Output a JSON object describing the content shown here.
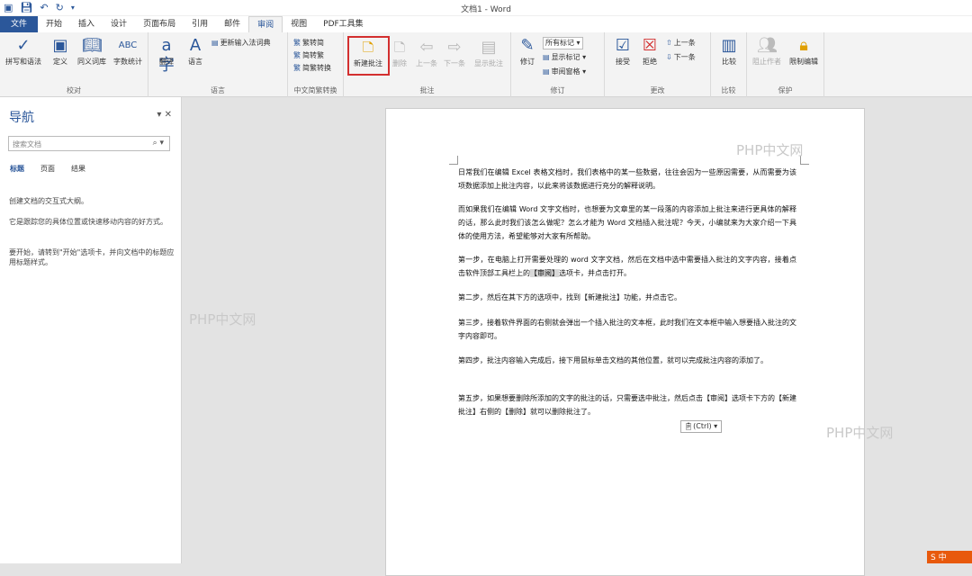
{
  "app": {
    "title": "文档1 - Word"
  },
  "quick_access": {
    "save_icon": "save-icon",
    "undo_icon": "undo-icon",
    "redo_icon": "redo-icon"
  },
  "tabs": [
    {
      "label": "文件"
    },
    {
      "label": "开始"
    },
    {
      "label": "插入"
    },
    {
      "label": "设计"
    },
    {
      "label": "页面布局"
    },
    {
      "label": "引用"
    },
    {
      "label": "邮件"
    },
    {
      "label": "审阅"
    },
    {
      "label": "视图"
    },
    {
      "label": "PDF工具集"
    }
  ],
  "ribbon": {
    "proofing": {
      "label": "校对",
      "spell": "拼写和语法",
      "define": "定义",
      "thesaurus": "同义词库",
      "wordcount": "字数统计"
    },
    "language": {
      "label": "语言",
      "translate": "翻译",
      "language": "语言",
      "update_ime": "更新输入法词典"
    },
    "chinese": {
      "label": "中文简繁转换",
      "to_simp": "繁转简",
      "to_trad": "简转繁",
      "convert": "简繁转换"
    },
    "comments": {
      "label": "批注",
      "new": "新建批注",
      "delete": "删除",
      "prev": "上一条",
      "next": "下一条",
      "show": "显示批注"
    },
    "tracking": {
      "label": "修订",
      "track": "修订",
      "all_markup": "所有标记",
      "show_markup": "显示标记",
      "review_pane": "审阅窗格"
    },
    "changes": {
      "label": "更改",
      "accept": "接受",
      "reject": "拒绝",
      "prev": "上一条",
      "next": "下一条"
    },
    "compare": {
      "label": "比较",
      "compare": "比较"
    },
    "protect": {
      "label": "保护",
      "block": "阻止作者",
      "restrict": "限制编辑"
    }
  },
  "nav": {
    "title": "导航",
    "search_placeholder": "搜索文档",
    "tabs": [
      "标题",
      "页面",
      "结果"
    ],
    "p1": "创建文档的交互式大纲。",
    "p2": "它是跟踪您的具体位置或快速移动内容的好方式。",
    "p3": "要开始，请转到\"开始\"选项卡，并向文档中的标题应用标题样式。"
  },
  "document": {
    "p1": "日常我们在编辑 Excel 表格文档时，我们表格中的某一些数据，往往会因为一些原因需要，从而需要为该项数据添加上批注内容，以此来将该数据进行充分的解释说明。",
    "p2": "而如果我们在编辑 Word 文字文档时，也想要为文章里的某一段落的内容添加上批注来进行更具体的解释的话，那么此时我们该怎么做呢？怎么才能为 Word 文档插入批注呢？今天，小编就来为大家介绍一下具体的使用方法，希望能够对大家有所帮助。",
    "p3a": "第一步，在电脑上打开需要处理的 word 文字文档，然后在文档中选中需要插入批注的文字内容，接着点击软件顶部工具栏上的",
    "p3b": "【审阅】",
    "p3c": "选项卡，并点击打开。",
    "p4": "第二步，然后在其下方的选项中，找到【新建批注】功能，并点击它。",
    "p5": "第三步，接着软件界面的右侧就会弹出一个插入批注的文本框，此时我们在文本框中输入想要插入批注的文字内容即可。",
    "p6": "第四步，批注内容输入完成后，接下用鼠标单击文档的其他位置，就可以完成批注内容的添加了。",
    "p7": "第五步，如果想要删除所添加的文字的批注的话，只需要选中批注，然后点击【审阅】选项卡下方的【新建批注】右侧的【删除】就可以删除批注了。"
  },
  "paste": {
    "label": "(Ctrl)"
  },
  "watermark": {
    "text": "PHP中文网"
  },
  "corner_logo": {
    "text": "S 中"
  }
}
